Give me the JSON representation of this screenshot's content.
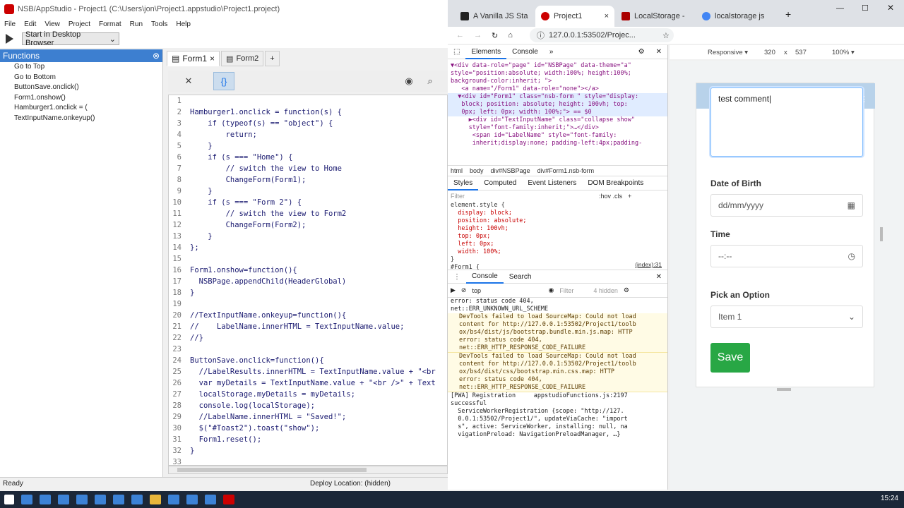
{
  "appstudio": {
    "title": "NSB/AppStudio - Project1 (C:\\Users\\jon\\Project1.appstudio\\Project1.project)",
    "menu": [
      "File",
      "Edit",
      "View",
      "Project",
      "Format",
      "Run",
      "Tools",
      "Help"
    ],
    "run_target": "Start in Desktop Browser",
    "functions_header": "Functions",
    "functions": [
      "Go to Top",
      "Go to Bottom",
      "ButtonSave.onclick()",
      "Form1.onshow()",
      "Hamburger1.onclick = (",
      "TextInputName.onkeyup()"
    ],
    "tabs": [
      "Form1",
      "Form2",
      "+"
    ],
    "code_lines": [
      {
        "n": "1",
        "t": ""
      },
      {
        "n": "2",
        "t": "Hamburger1.onclick = function(s) {"
      },
      {
        "n": "3",
        "t": "    if (typeof(s) == \"object\") {"
      },
      {
        "n": "4",
        "t": "        return;"
      },
      {
        "n": "5",
        "t": "    }"
      },
      {
        "n": "6",
        "t": "    if (s === \"Home\") {"
      },
      {
        "n": "7",
        "t": "        // switch the view to Home"
      },
      {
        "n": "8",
        "t": "        ChangeForm(Form1);"
      },
      {
        "n": "9",
        "t": "    }"
      },
      {
        "n": "10",
        "t": "    if (s === \"Form 2\") {"
      },
      {
        "n": "11",
        "t": "        // switch the view to Form2"
      },
      {
        "n": "12",
        "t": "        ChangeForm(Form2);"
      },
      {
        "n": "13",
        "t": "    }"
      },
      {
        "n": "14",
        "t": "};"
      },
      {
        "n": "15",
        "t": ""
      },
      {
        "n": "16",
        "t": "Form1.onshow=function(){"
      },
      {
        "n": "17",
        "t": "  NSBPage.appendChild(HeaderGlobal)"
      },
      {
        "n": "18",
        "t": "}"
      },
      {
        "n": "19",
        "t": ""
      },
      {
        "n": "20",
        "t": "//TextInputName.onkeyup=function(){"
      },
      {
        "n": "21",
        "t": "//    LabelName.innerHTML = TextInputName.value;"
      },
      {
        "n": "22",
        "t": "//}"
      },
      {
        "n": "23",
        "t": ""
      },
      {
        "n": "24",
        "t": "ButtonSave.onclick=function(){"
      },
      {
        "n": "25",
        "t": "  //LabelResults.innerHTML = TextInputName.value + \"<br"
      },
      {
        "n": "26",
        "t": "  var myDetails = TextInputName.value + \"<br />\" + Text"
      },
      {
        "n": "27",
        "t": "  localStorage.myDetails = myDetails;"
      },
      {
        "n": "28",
        "t": "  console.log(localStorage);"
      },
      {
        "n": "29",
        "t": "  //LabelName.innerHTML = \"Saved!\";"
      },
      {
        "n": "30",
        "t": "  $(\"#Toast2\").toast(\"show\");"
      },
      {
        "n": "31",
        "t": "  Form1.reset();"
      },
      {
        "n": "32",
        "t": "}"
      },
      {
        "n": "33",
        "t": ""
      }
    ],
    "status": "Ready",
    "deploy": "Deploy Location: (hidden)"
  },
  "chrome": {
    "tabs": [
      "A Vanilla JS Sta",
      "Project1",
      "LocalStorage -",
      "localstorage js"
    ],
    "url": "127.0.0.1:53502/Projec..."
  },
  "devtools": {
    "main_tabs": [
      "Elements",
      "Console"
    ],
    "elements_lines": [
      "▼<div data-role=\"page\" id=\"NSBPage\" data-theme=\"a\"",
      "style=\"position:absolute; width:100%; height:100%;",
      "background-color:inherit; \">",
      "   <a name=\"/Form1\" data-role=\"none\"></a>",
      "  ▼<div id=\"Form1\" class=\"nsb-form \" style=\"display:",
      "   block; position: absolute; height: 100vh; top:",
      "   0px; left: 0px; width: 100%;\"> == $0",
      "     ▶<div id=\"TextInputName\" class=\"collapse show\"",
      "     style=\"font-family:inherit;\">…</div>",
      "      <span id=\"LabelName\" style=\"font-family:",
      "      inherit;display:none; padding-left:4px;padding-"
    ],
    "breadcrumb": [
      "html",
      "body",
      "div#NSBPage",
      "div#Form1.nsb-form"
    ],
    "style_tabs": [
      "Styles",
      "Computed",
      "Event Listeners",
      "DOM Breakpoints"
    ],
    "filter": "Filter",
    "hov": ":hov  .cls",
    "style_lines": [
      "element.style {",
      "  display: block;",
      "  position: absolute;",
      "  height: 100vh;",
      "  top: 0px;",
      "  left: 0px;",
      "  width: 100%;",
      "}",
      "#Form1 {"
    ],
    "style_source": "(index):31",
    "drawer_tabs": [
      "Console",
      "Search"
    ],
    "console_context": "top",
    "console_filter": "Filter",
    "hidden_count": "4 hidden",
    "console_lines": [
      {
        "w": false,
        "t": "error: status code 404,\nnet::ERR_UNKNOWN_URL_SCHEME"
      },
      {
        "w": true,
        "t": "DevTools failed to load SourceMap: Could not load\ncontent for http://127.0.0.1:53502/Project1/toolb\nox/bs4/dist/js/bootstrap.bundle.min.js.map: HTTP\nerror: status code 404,\nnet::ERR_HTTP_RESPONSE_CODE_FAILURE"
      },
      {
        "w": true,
        "t": "DevTools failed to load SourceMap: Could not load\ncontent for http://127.0.0.1:53502/Project1/toolb\nox/bs4/dist/css/bootstrap.min.css.map: HTTP\nerror: status code 404,\nnet::ERR_HTTP_RESPONSE_CODE_FAILURE"
      },
      {
        "w": false,
        "t": "[PWA] Registration     appstudioFunctions.js:2197\nsuccessful\n  ServiceWorkerRegistration {scope: \"http://127.\n  0.0.1:53502/Project1/\", updateViaCache: \"import\n  s\", active: ServiceWorker, installing: null, na\n  vigationPreload: NavigationPreloadManager, …}"
      }
    ]
  },
  "device": {
    "mode": "Responsive",
    "width": "320",
    "x": "x",
    "height": "537",
    "zoom": "100%"
  },
  "form": {
    "comment": "test comment",
    "dob_label": "Date of Birth",
    "dob_placeholder": "dd/mm/yyyy",
    "time_label": "Time",
    "time_placeholder": "--:--",
    "option_label": "Pick an Option",
    "option_value": "Item 1",
    "save_label": "Save"
  },
  "clock": "15:24"
}
